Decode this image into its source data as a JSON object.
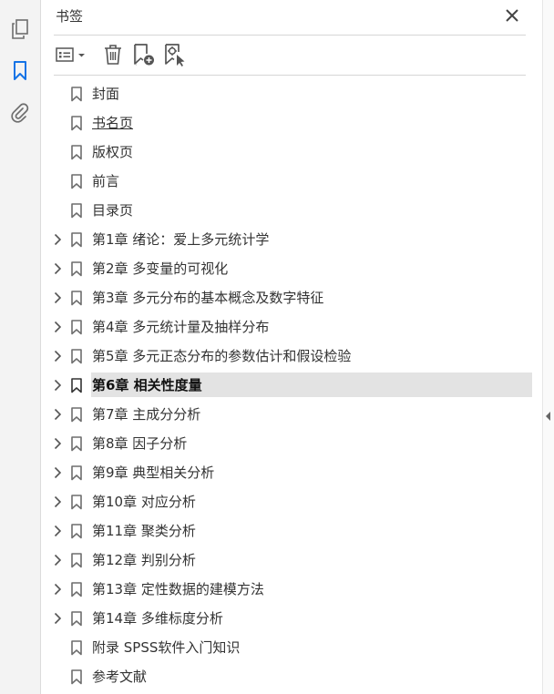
{
  "panel": {
    "title": "书签"
  },
  "rail": {
    "icons": [
      "pages-icon",
      "bookmark-icon",
      "attachment-icon"
    ],
    "active": "bookmark-icon",
    "accent_color": "#1473e6"
  },
  "toolbar": {
    "icons": [
      "options-menu-icon",
      "delete-bookmark-icon",
      "new-bookmark-icon",
      "new-bookmark-from-structure-icon"
    ]
  },
  "bookmarks": [
    {
      "label": "封面",
      "expandable": false
    },
    {
      "label": "书名页",
      "expandable": false,
      "underlined": true
    },
    {
      "label": "版权页",
      "expandable": false
    },
    {
      "label": "前言",
      "expandable": false
    },
    {
      "label": "目录页",
      "expandable": false
    },
    {
      "label": "第1章  绪论：爱上多元统计学",
      "expandable": true
    },
    {
      "label": "第2章  多变量的可视化",
      "expandable": true
    },
    {
      "label": "第3章  多元分布的基本概念及数字特征",
      "expandable": true
    },
    {
      "label": "第4章  多元统计量及抽样分布",
      "expandable": true
    },
    {
      "label": "第5章  多元正态分布的参数估计和假设检验",
      "expandable": true
    },
    {
      "label": "第6章  相关性度量",
      "expandable": true,
      "selected": true
    },
    {
      "label": "第7章  主成分分析",
      "expandable": true
    },
    {
      "label": "第8章  因子分析",
      "expandable": true
    },
    {
      "label": "第9章  典型相关分析",
      "expandable": true
    },
    {
      "label": "第10章  对应分析",
      "expandable": true
    },
    {
      "label": "第11章  聚类分析",
      "expandable": true
    },
    {
      "label": "第12章  判别分析",
      "expandable": true
    },
    {
      "label": "第13章  定性数据的建模方法",
      "expandable": true
    },
    {
      "label": "第14章  多维标度分析",
      "expandable": true
    },
    {
      "label": "附录  SPSS软件入门知识",
      "expandable": false
    },
    {
      "label": "参考文献",
      "expandable": false
    }
  ]
}
